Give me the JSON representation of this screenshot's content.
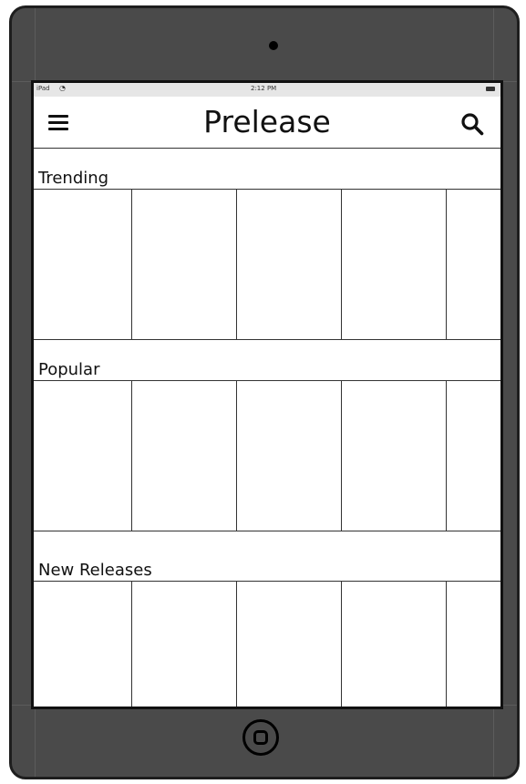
{
  "statusbar": {
    "carrier": "iPad",
    "time": "2:12 PM"
  },
  "header": {
    "title": "Prelease",
    "menu_icon": "hamburger-menu-icon",
    "search_icon": "search-icon"
  },
  "sections": [
    {
      "label": "Trending"
    },
    {
      "label": "Popular"
    },
    {
      "label": "New Releases"
    }
  ]
}
